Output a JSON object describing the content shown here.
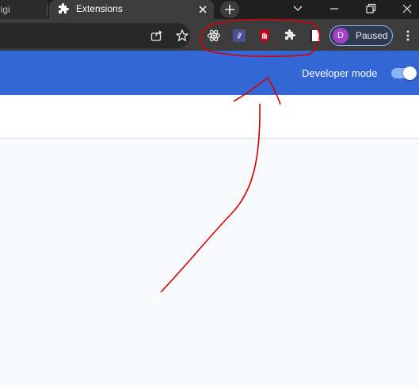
{
  "tabs": {
    "inactive_title": "s Origi",
    "active_title": "Extensions"
  },
  "profile": {
    "initial": "D",
    "status": "Paused"
  },
  "extensions_page": {
    "developer_mode_label": "Developer mode",
    "developer_mode_enabled": true
  },
  "toolbar_icons": [
    "share-icon",
    "star-icon",
    "react-devtools-icon",
    "extension-icon",
    "ublock-icon",
    "puzzle-icon",
    "notes-icon",
    "more-icon"
  ],
  "colors": {
    "header_blue": "#3367d6",
    "toggle_blue": "#8ab4f8",
    "avatar_purple": "#a142c8",
    "annotation_red": "#d50000"
  }
}
